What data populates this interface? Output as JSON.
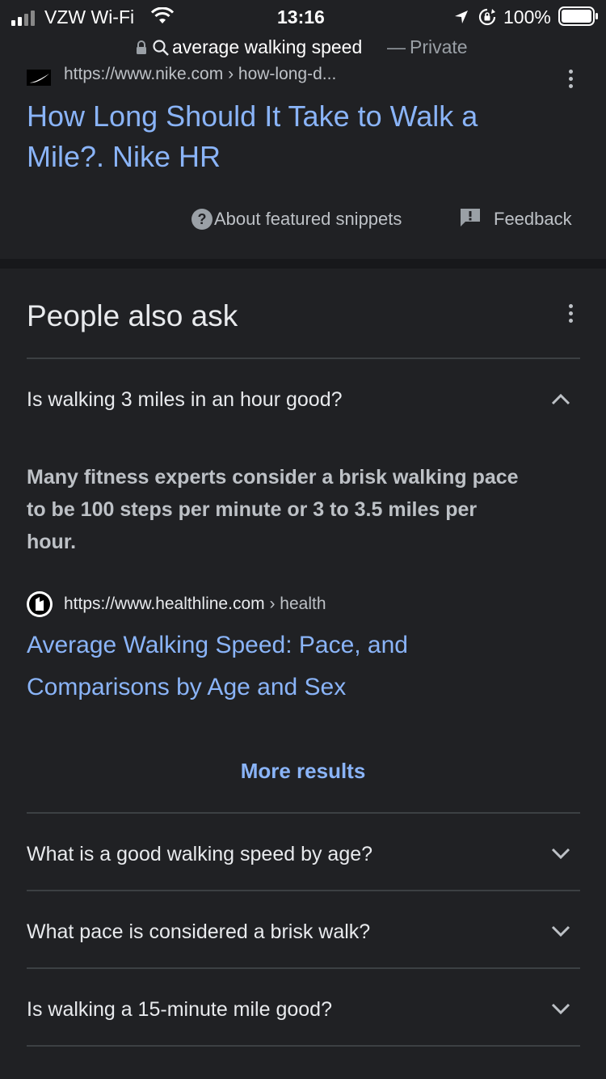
{
  "status_bar": {
    "carrier": "VZW Wi-Fi",
    "time": "13:16",
    "battery": "100%",
    "icons": [
      "signal-icon",
      "wifi-icon",
      "location-icon",
      "rotation-lock-icon",
      "battery-icon"
    ]
  },
  "url_bar": {
    "query": "average walking speed",
    "separator": "—",
    "mode": "Private",
    "icons": [
      "lock-icon",
      "search-icon"
    ]
  },
  "top_result": {
    "source_url": "https://www.nike.com › how-long-d...",
    "title_line1": "How Long Should It Take to Walk a",
    "title_line2": "Mile?. Nike HR",
    "about_snippets": "About featured snippets",
    "feedback": "Feedback"
  },
  "people_also_ask": {
    "heading": "People also ask",
    "expanded": {
      "question": "Is walking 3 miles in an hour good?",
      "answer_line1": "Many fitness experts consider a brisk walking pace",
      "answer_line2": "to be 100 steps per minute or 3 to 3.5 miles per",
      "answer_line3": "hour.",
      "source_domain": "https://www.healthline.com",
      "source_path": " › health",
      "link_line1": "Average Walking Speed: Pace, and",
      "link_line2": "Comparisons by Age and Sex",
      "more_results": "More results"
    },
    "questions": [
      "What is a good walking speed by age?",
      "What pace is considered a brisk walk?",
      "Is walking a 15-minute mile good?"
    ]
  },
  "colors": {
    "background": "#202124",
    "link": "#8ab4f8",
    "text": "#e8eaed",
    "secondary": "#bdc1c6",
    "divider": "#3c4043"
  }
}
